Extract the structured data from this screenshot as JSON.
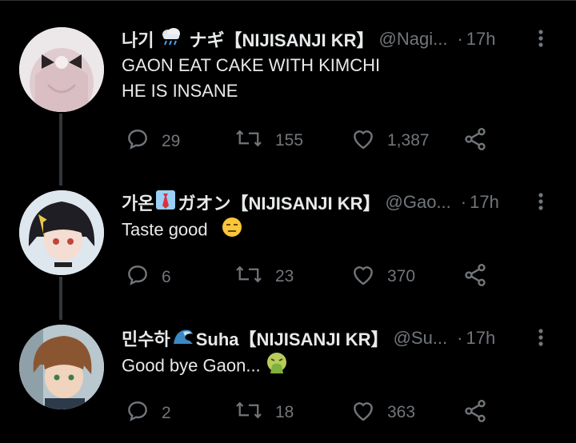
{
  "tweets": [
    {
      "display_name": "나기",
      "name_suffix": "ナギ【NIJISANJI KR】",
      "handle": "@Nagi...",
      "separator": "·",
      "time": "17h",
      "text_lines": [
        "GAON EAT CAKE WITH KIMCHI",
        "HE IS INSANE"
      ],
      "replies": "29",
      "retweets": "155",
      "likes": "1,387",
      "name_emoji": "rain-cloud-icon"
    },
    {
      "display_name": "가온",
      "name_suffix": "ガオン【NIJISANJI KR】",
      "handle": "@Gao...",
      "separator": "·",
      "time": "17h",
      "text_lines": [
        "Taste good"
      ],
      "replies": "6",
      "retweets": "23",
      "likes": "370",
      "name_emoji": "necktie-icon",
      "text_emoji": "expressionless-face-icon"
    },
    {
      "display_name": "민수하",
      "name_suffix": "Suha【NIJISANJI KR】",
      "handle": "@Su...",
      "separator": "·",
      "time": "17h",
      "text_lines": [
        "Good bye Gaon..."
      ],
      "replies": "2",
      "retweets": "18",
      "likes": "363",
      "name_emoji": "wave-icon",
      "text_emoji": "vomiting-face-icon"
    }
  ],
  "colors": {
    "background": "#000000",
    "text": "#e7e9ea",
    "muted": "#71767b",
    "thread_line": "#333639"
  }
}
